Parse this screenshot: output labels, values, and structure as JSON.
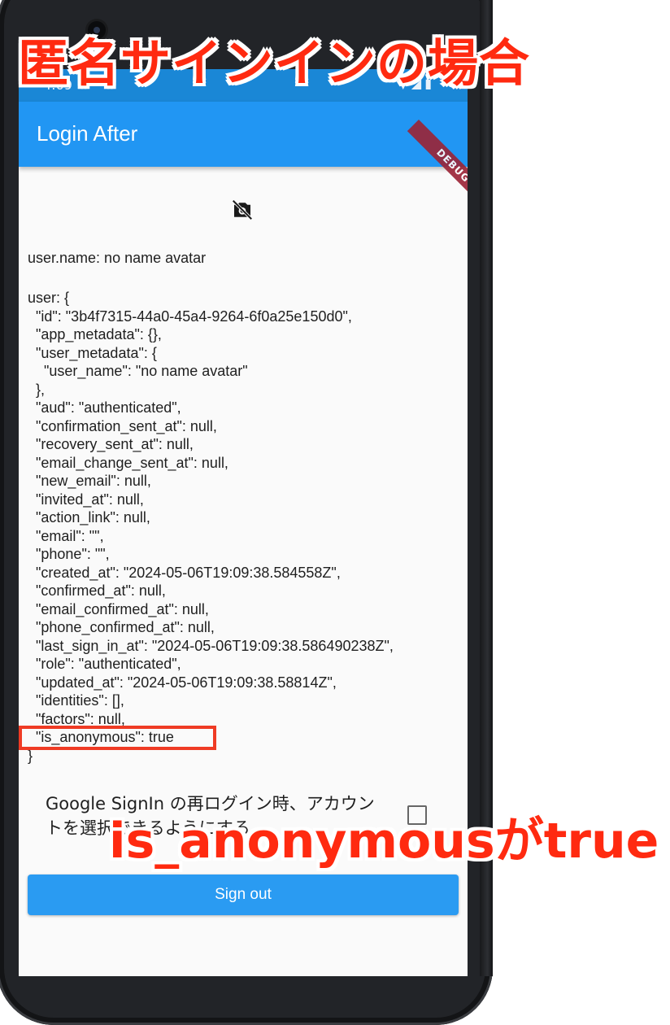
{
  "overlay": {
    "title": "匿名サインインの場合",
    "note": "is_anonymousがtrue"
  },
  "status_bar": {
    "time": "4:09",
    "icons": [
      "settings-icon",
      "wifi-icon",
      "signal-icon",
      "battery-icon"
    ]
  },
  "app_bar": {
    "title": "Login After",
    "debug_banner": "DEBUG"
  },
  "avatar": {
    "icon": "no-photography-icon"
  },
  "user_name_line": "user.name: no name avatar",
  "user_json_lines": [
    "user: {",
    "  \"id\": \"3b4f7315-44a0-45a4-9264-6f0a25e150d0\",",
    "  \"app_metadata\": {},",
    "  \"user_metadata\": {",
    "    \"user_name\": \"no name avatar\"",
    "  },",
    "  \"aud\": \"authenticated\",",
    "  \"confirmation_sent_at\": null,",
    "  \"recovery_sent_at\": null,",
    "  \"email_change_sent_at\": null,",
    "  \"new_email\": null,",
    "  \"invited_at\": null,",
    "  \"action_link\": null,",
    "  \"email\": \"\",",
    "  \"phone\": \"\",",
    "  \"created_at\": \"2024-05-06T19:09:38.584558Z\",",
    "  \"confirmed_at\": null,",
    "  \"email_confirmed_at\": null,",
    "  \"phone_confirmed_at\": null,",
    "  \"last_sign_in_at\": \"2024-05-06T19:09:38.586490238Z\",",
    "  \"role\": \"authenticated\",",
    "  \"updated_at\": \"2024-05-06T19:09:38.58814Z\",",
    "  \"identities\": [],",
    "  \"factors\": null,",
    "  \"is_anonymous\": true",
    "}"
  ],
  "google_option": {
    "label": "Google SignIn の再ログイン時、アカウントを選択できるようにする",
    "checked": false
  },
  "sign_out_button": "Sign out",
  "colors": {
    "app_bar": "#2196f3",
    "status_bar": "#1a87d6",
    "button": "#2a9bf2",
    "annotation": "#ff2a10"
  }
}
